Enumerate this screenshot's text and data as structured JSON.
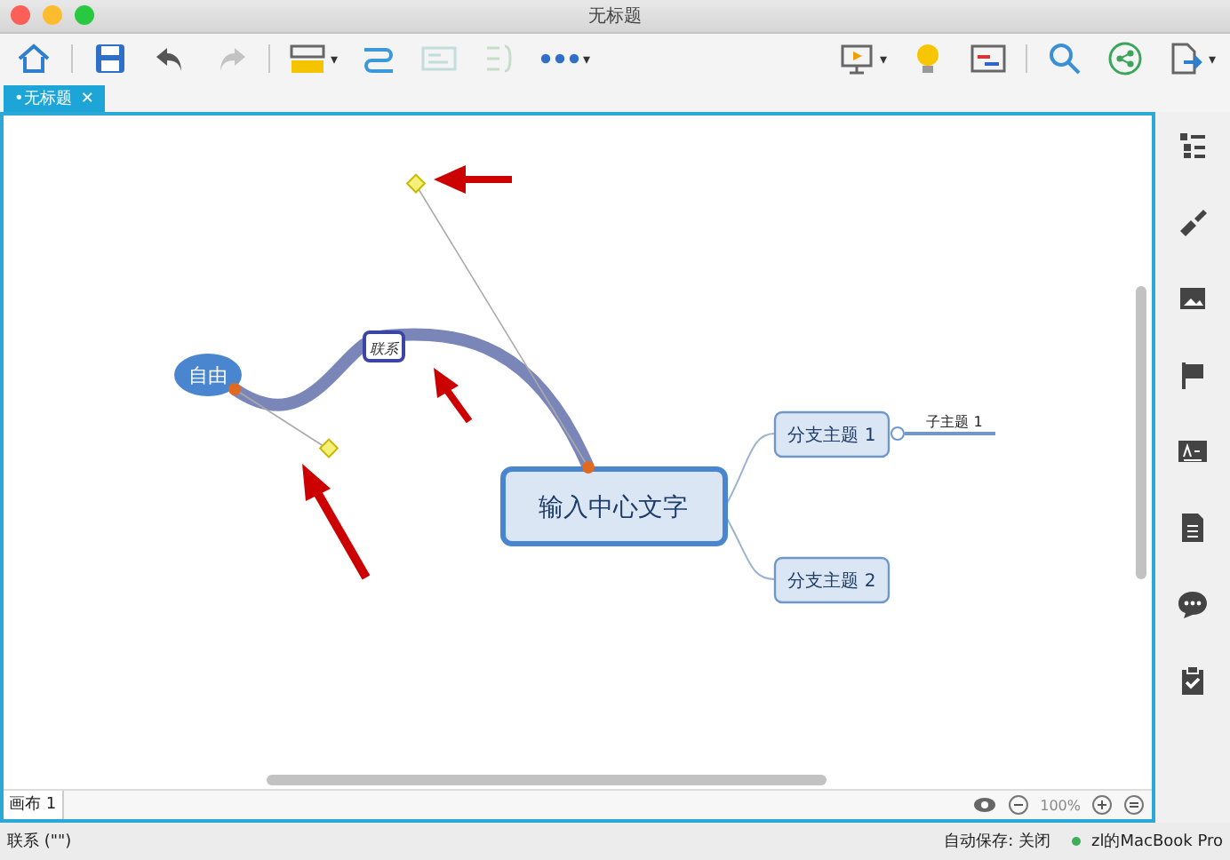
{
  "window": {
    "title": "无标题"
  },
  "toolbar": [
    {
      "kind": "home",
      "disabled": false
    },
    {
      "kind": "sep"
    },
    {
      "kind": "save",
      "disabled": false
    },
    {
      "kind": "undo",
      "disabled": false
    },
    {
      "kind": "redo",
      "disabled": true
    },
    {
      "kind": "sep"
    },
    {
      "kind": "style",
      "disabled": false,
      "caret": "▾"
    },
    {
      "kind": "relation",
      "disabled": false
    },
    {
      "kind": "boundary",
      "disabled": true
    },
    {
      "kind": "summary",
      "disabled": true
    },
    {
      "kind": "more",
      "disabled": false,
      "caret": "▾"
    },
    {
      "kind": "spacer"
    },
    {
      "kind": "present",
      "disabled": false,
      "caret": "▾"
    },
    {
      "kind": "idea",
      "disabled": false
    },
    {
      "kind": "gantt",
      "disabled": false
    },
    {
      "kind": "sep"
    },
    {
      "kind": "search",
      "disabled": false
    },
    {
      "kind": "share",
      "disabled": false
    },
    {
      "kind": "export",
      "disabled": false,
      "caret": "▾"
    }
  ],
  "tabs": [
    {
      "label": "•无标题",
      "close": "✕",
      "selected": true
    }
  ],
  "canvas": {
    "central_topic": "输入中心文字",
    "floating_topic": "自由",
    "relationship_label": "联系",
    "branches": [
      {
        "label": "分支主题 1",
        "children": [
          {
            "label": "子主题 1"
          }
        ]
      },
      {
        "label": "分支主题 2"
      }
    ]
  },
  "sheet_bar": {
    "sheet": "画布 1",
    "zoom": "100%"
  },
  "status_bar": {
    "left": "联系 (\"\")",
    "autosave": "自动保存: 关闭",
    "user": "zl的MacBook Pro"
  }
}
